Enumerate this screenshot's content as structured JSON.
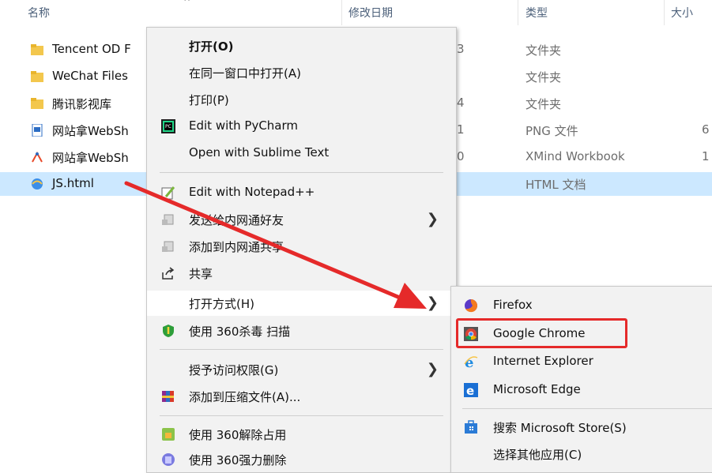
{
  "header": {
    "name": "名称",
    "modified": "修改日期",
    "type": "类型",
    "size": "大小",
    "extra": "^"
  },
  "files": [
    {
      "name": "Tencent OD F",
      "date": "3",
      "type": "文件夹",
      "size": "",
      "icon": "folder-icon"
    },
    {
      "name": "WeChat Files",
      "date": "",
      "type": "文件夹",
      "size": "",
      "icon": "folder-icon"
    },
    {
      "name": "腾讯影视库",
      "date": "4",
      "type": "文件夹",
      "size": "",
      "icon": "folder-icon"
    },
    {
      "name": "网站拿WebSh",
      "date": "1",
      "type": "PNG 文件",
      "size": "6",
      "icon": "png-file-icon"
    },
    {
      "name": "网站拿WebSh",
      "date": "0",
      "type": "XMind Workbook",
      "size": "1",
      "icon": "xmind-file-icon"
    },
    {
      "name": "JS.html",
      "date": "",
      "type": "HTML 文档",
      "size": "",
      "icon": "html-file-icon"
    }
  ],
  "context_menu": {
    "open": "打开(O)",
    "open_same_window": "在同一窗口中打开(A)",
    "print": "打印(P)",
    "edit_pycharm": "Edit with PyCharm",
    "open_sublime": "Open with Sublime Text",
    "edit_notepadpp": "Edit with Notepad++",
    "send_lan_friend": "发送给内网通好友",
    "add_lan_share": "添加到内网通共享",
    "share": "共享",
    "open_with": "打开方式(H)",
    "scan_360": "使用 360杀毒 扫描",
    "grant_access": "授予访问权限(G)",
    "add_archive": "添加到压缩文件(A)...",
    "unlock_360": "使用 360解除占用",
    "force_delete_360": "使用 360强力删除"
  },
  "open_with_menu": {
    "firefox": "Firefox",
    "chrome": "Google Chrome",
    "ie": "Internet Explorer",
    "edge": "Microsoft Edge",
    "store_search": "搜索 Microsoft Store(S)",
    "choose_other": "选择其他应用(C)"
  },
  "colors": {
    "selection": "#cce8ff",
    "highlight": "#e52a2a",
    "menu_bg": "#f2f2f2"
  }
}
